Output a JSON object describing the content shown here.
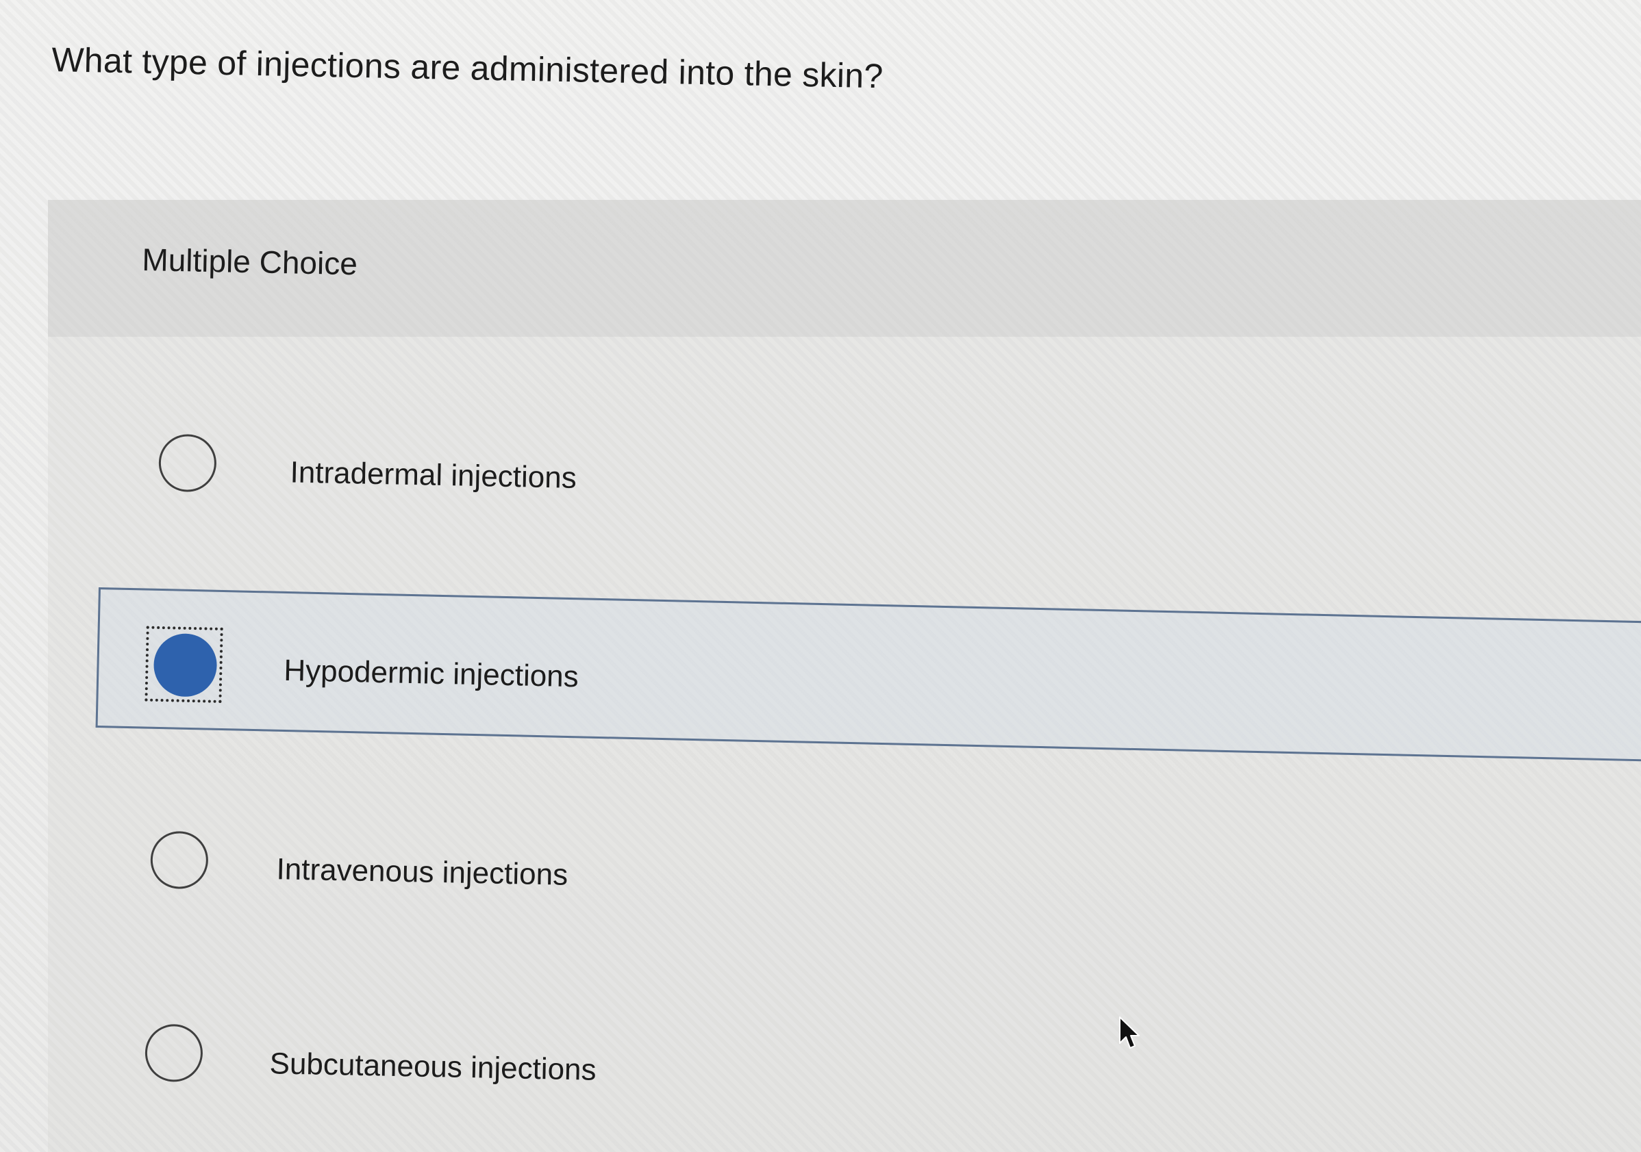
{
  "question": {
    "text": "What type of injections are administered into the skin?"
  },
  "section": {
    "label": "Multiple Choice"
  },
  "options": [
    {
      "label": "Intradermal injections",
      "selected": false
    },
    {
      "label": "Hypodermic injections",
      "selected": true
    },
    {
      "label": "Intravenous injections",
      "selected": false
    },
    {
      "label": "Subcutaneous injections",
      "selected": false
    }
  ],
  "colors": {
    "selected_radio": "#2e62ad",
    "selected_border": "#5d7391",
    "background": "#ebebea"
  },
  "icons": {
    "cursor": "mouse-pointer-icon"
  }
}
